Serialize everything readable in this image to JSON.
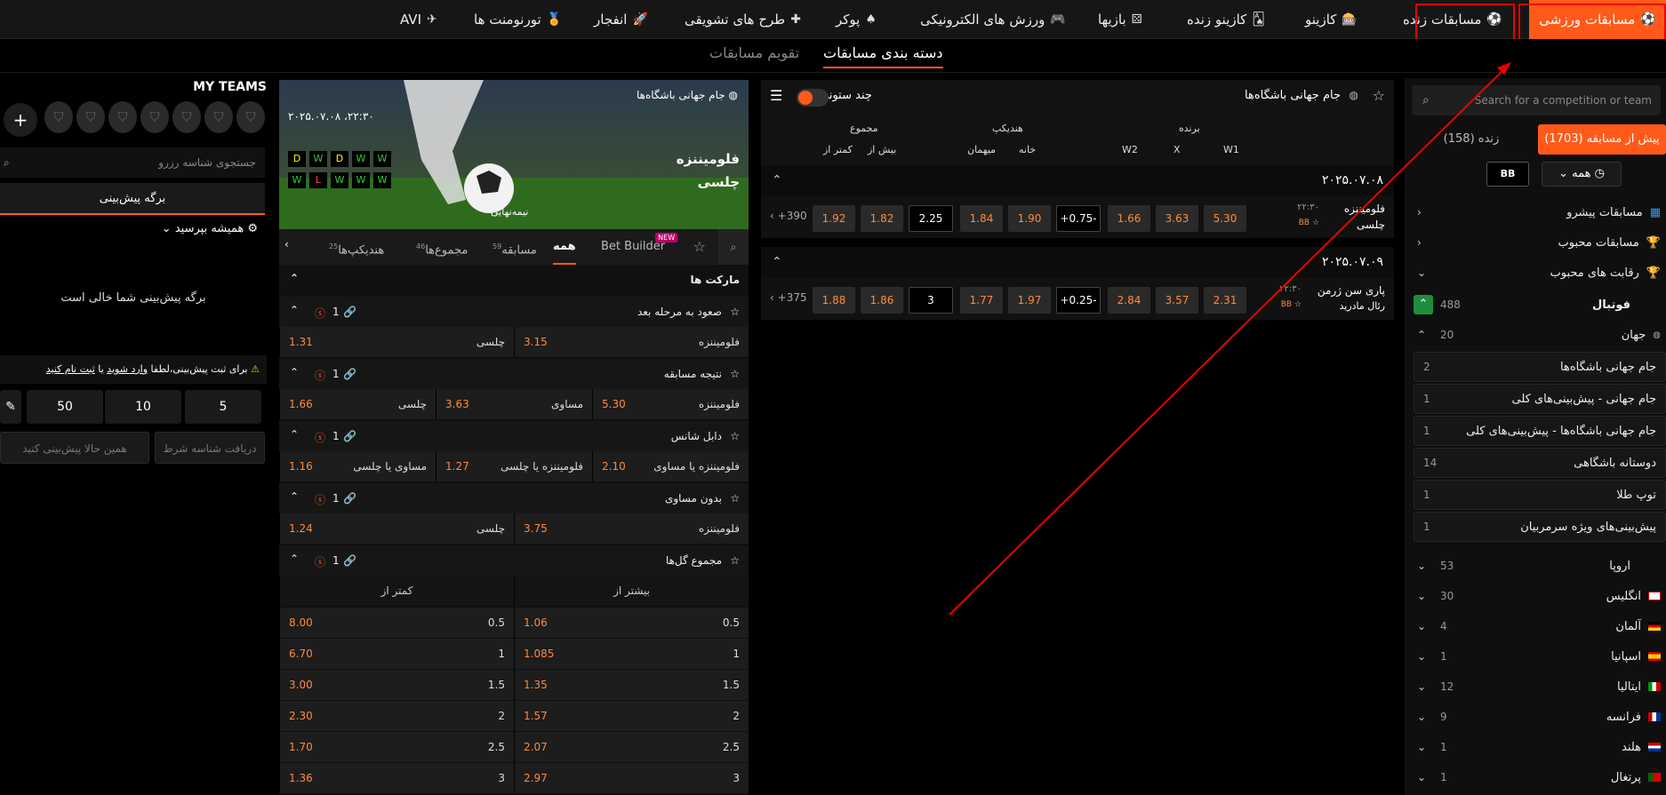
{
  "nav": {
    "items": [
      {
        "label": "مسابقات ورزشی",
        "icon": "soccer-ball-icon"
      },
      {
        "label": "مسابقات زنده",
        "icon": "soccer-ball-icon"
      },
      {
        "label": "کازینو",
        "icon": "slot-machine-icon"
      },
      {
        "label": "کازینو زنده",
        "icon": "cards-icon"
      },
      {
        "label": "بازیها",
        "icon": "dice-icon"
      },
      {
        "label": "ورزش های الکترونیکی",
        "icon": "gamepad-icon"
      },
      {
        "label": "پوکر",
        "icon": "spade-icon"
      },
      {
        "label": "طرح های تشویقی",
        "icon": "gift-icon"
      },
      {
        "label": "انفجار",
        "icon": "rocket-icon"
      },
      {
        "label": "تورنومنت ها",
        "icon": "medal-icon"
      },
      {
        "label": "AVI",
        "icon": "plane-icon"
      }
    ]
  },
  "subnav": {
    "active": "دسته بندی مسابقات",
    "other": "تقویم مسابقات"
  },
  "sidebar": {
    "search_placeholder": "Search for a competition or team",
    "tab_live": "زنده (158)",
    "tab_prematch": "پیش از مسابقه (1703)",
    "filter_all": "همه",
    "filter_bb": "BB",
    "items": [
      {
        "label": "مسابقات پیشرو"
      },
      {
        "label": "مسابقات محبوب"
      },
      {
        "label": "رقابت های محبوب"
      }
    ],
    "football": {
      "label": "فوتبال",
      "count": "488"
    },
    "world": {
      "label": "جهان",
      "count": "20"
    },
    "world_subs": [
      {
        "label": "جام جهانی باشگاه‌ها",
        "count": "2"
      },
      {
        "label": "جام جهانی - پیش‌بینی‌های کلی",
        "count": "1"
      },
      {
        "label": "جام جهانی باشگاه‌ها - پیش‌بینی‌های کلی",
        "count": "1"
      },
      {
        "label": "دوستانه باشگاهی",
        "count": "14"
      },
      {
        "label": "توپ طلا",
        "count": "1"
      },
      {
        "label": "پیش‌بینی‌های ویژه سرمربیان",
        "count": "1"
      }
    ],
    "countries": [
      {
        "label": "اروپا",
        "count": "53"
      },
      {
        "label": "انگلیس",
        "count": "30"
      },
      {
        "label": "آلمان",
        "count": "4"
      },
      {
        "label": "اسپانیا",
        "count": "1"
      },
      {
        "label": "ایتالیا",
        "count": "12"
      },
      {
        "label": "فرانسه",
        "count": "9"
      },
      {
        "label": "هلند",
        "count": "1"
      },
      {
        "label": "پرتغال",
        "count": "1"
      }
    ]
  },
  "center": {
    "competition": "جام جهانی باشگاه‌ها",
    "multi_column": "چند ستونی",
    "headers": {
      "winner": "برنده",
      "handicap": "هندیکپ",
      "total": "مجموع",
      "w1": "W1",
      "x": "X",
      "w2": "W2",
      "home": "خانه",
      "away": "میهمان",
      "over": "بیش از",
      "under": "کمتر از"
    },
    "days": [
      {
        "date": "۲۰۲۵.۰۷.۰۸",
        "match": {
          "time": "۲۲:۳۰",
          "team1": "فلومیننزه",
          "team2": "چلسی",
          "bb": "BB",
          "w1": "5.30",
          "x": "3.63",
          "w2": "1.66",
          "hcp": "+0.75-",
          "home": "1.90",
          "away": "1.84",
          "total": "2.25",
          "over": "1.82",
          "under": "1.92",
          "more": "+390"
        }
      },
      {
        "date": "۲۰۲۵.۰۷.۰۹",
        "match": {
          "time": "۲۲:۳۰",
          "team1": "پاری سن ژرمن",
          "team2": "رئال مادرید",
          "bb": "BB",
          "w1": "2.31",
          "x": "3.57",
          "w2": "2.84",
          "hcp": "+0.25-",
          "home": "1.97",
          "away": "1.77",
          "total": "3",
          "over": "1.86",
          "under": "1.88",
          "more": "+375"
        }
      }
    ]
  },
  "match": {
    "competition": "جام جهانی باشگاه‌ها",
    "datetime": "۲۰۲۵.۰۷.۰۸ ،۲۲:۳۰",
    "team1": "فلومیننزه",
    "team2": "چلسی",
    "stage": "نیمه‌نهایی",
    "form1": [
      "W",
      "W",
      "D",
      "W",
      "D"
    ],
    "form2": [
      "W",
      "W",
      "W",
      "L",
      "W"
    ],
    "tabs": [
      {
        "label": "Bet Builder",
        "badge": "NEW"
      },
      {
        "label": "همه",
        "count": ""
      },
      {
        "label": "مسابقه",
        "count": "59"
      },
      {
        "label": "مجموع‌ها",
        "count": "46"
      },
      {
        "label": "هندیکپ‌ها",
        "count": "25"
      }
    ],
    "markets_title": "مارکت ها",
    "markets": [
      {
        "title": "صعود به مرحله بعد",
        "n": "1",
        "cells": [
          {
            "l": "فلومیننزه",
            "v": "3.15"
          },
          {
            "l": "چلسی",
            "v": "1.31"
          }
        ]
      },
      {
        "title": "نتیجه مسابقه",
        "n": "1",
        "cells": [
          {
            "l": "فلومیننزه",
            "v": "5.30"
          },
          {
            "l": "مساوی",
            "v": "3.63"
          },
          {
            "l": "چلسی",
            "v": "1.66"
          }
        ]
      },
      {
        "title": "دابل شانس",
        "n": "1",
        "cells": [
          {
            "l": "فلومیننزه یا مساوی",
            "v": "2.10"
          },
          {
            "l": "فلومیننزه یا چلسی",
            "v": "1.27"
          },
          {
            "l": "مساوی یا چلسی",
            "v": "1.16"
          }
        ]
      },
      {
        "title": "بدون مساوی",
        "n": "1",
        "cells": [
          {
            "l": "فلومیننزه",
            "v": "3.75"
          },
          {
            "l": "چلسی",
            "v": "1.24"
          }
        ]
      }
    ],
    "totals": {
      "title": "مجموع گل‌ها",
      "n": "1",
      "over": "بیشتر از",
      "under": "کمتر از",
      "rows": [
        {
          "line": "0.5",
          "over": "1.06",
          "under": "8.00"
        },
        {
          "line": "1",
          "over": "1.085",
          "under": "6.70"
        },
        {
          "line": "1.5",
          "over": "1.35",
          "under": "3.00"
        },
        {
          "line": "2",
          "over": "1.57",
          "under": "2.30"
        },
        {
          "line": "2.5",
          "over": "2.07",
          "under": "1.70"
        },
        {
          "line": "3",
          "over": "2.97",
          "under": "1.36"
        }
      ]
    }
  },
  "betslip": {
    "my_teams": "MY TEAMS",
    "search_placeholder": "جستجوی شناسه رزرو",
    "tab": "برگه پیش‌بینی",
    "always_ask": "همیشه بپرسید",
    "empty": "برگه پیش‌بینی شما خالی است",
    "warning_pre": "برای ثبت پیش‌بینی،لطفا",
    "login": "وارد شوید",
    "or": "یا",
    "register": "ثبت نام کنید",
    "stakes": [
      "5",
      "10",
      "50"
    ],
    "get_id": "دریافت شناسه شرط",
    "bet_now": "همین حالا پیش‌بینی کنید"
  },
  "colors": {
    "accent": "#ff5a1a",
    "odds": "#ff8a3c",
    "annotation": "#e00000"
  }
}
